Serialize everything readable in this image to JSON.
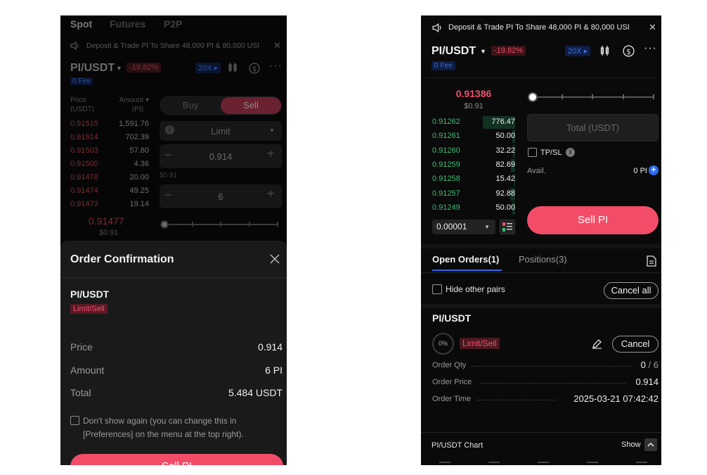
{
  "left": {
    "tabs": [
      "Spot",
      "Futures",
      "P2P"
    ],
    "announcement": "Deposit & Trade PI To Share  48,000 PI & 80,000 USI",
    "pair": "PI/USDT",
    "change": "-19.82%",
    "leverage": "20X",
    "fee_badge": "0 Fee",
    "ob_price_header": "Price",
    "ob_price_unit": "(USDT)",
    "ob_amount_header": "Amount",
    "ob_amount_unit": "(PI)",
    "asks": [
      {
        "price": "0.91515",
        "amount": "1,591.76"
      },
      {
        "price": "0.91514",
        "amount": "702.39"
      },
      {
        "price": "0.91503",
        "amount": "57.80"
      },
      {
        "price": "0.91500",
        "amount": "4.36"
      },
      {
        "price": "0.91478",
        "amount": "20.00"
      },
      {
        "price": "0.91474",
        "amount": "49.25"
      },
      {
        "price": "0.91473",
        "amount": "19.14"
      }
    ],
    "last_price": "0.91477",
    "last_usd": "$0.91",
    "buy_label": "Buy",
    "sell_label": "Sell",
    "order_type": "Limit",
    "price_value": "0.914",
    "price_hint": "$0.91",
    "amount_value": "6",
    "modal": {
      "title": "Order Confirmation",
      "pair": "PI/USDT",
      "order_tag": "Limit/Sell",
      "price_label": "Price",
      "price_value": "0.914",
      "amount_label": "Amount",
      "amount_value": "6 PI",
      "total_label": "Total",
      "total_value": "5.484 USDT",
      "dont_show_line1": "Don't show again (you can change this in",
      "dont_show_line2": "[Preferences] on the menu at the top right).",
      "sell_button": "Sell PI"
    }
  },
  "right": {
    "announcement": "Deposit & Trade PI To Share  48,000 PI & 80,000 USI",
    "pair": "PI/USDT",
    "change": "-19.82%",
    "leverage": "20X",
    "fee_badge": "0 Fee",
    "last_price": "0.91386",
    "last_usd": "$0.91",
    "bids": [
      {
        "price": "0.91262",
        "amount": "776.47"
      },
      {
        "price": "0.91261",
        "amount": "50.00"
      },
      {
        "price": "0.91260",
        "amount": "32.22"
      },
      {
        "price": "0.91259",
        "amount": "82.69"
      },
      {
        "price": "0.91258",
        "amount": "15.42"
      },
      {
        "price": "0.91257",
        "amount": "92.88"
      },
      {
        "price": "0.91249",
        "amount": "50.00"
      }
    ],
    "precision": "0.00001",
    "total_placeholder": "Total (USDT)",
    "tpsl_label": "TP/SL",
    "avail_label": "Avail.",
    "avail_value": "0 PI",
    "sell_button": "Sell PI",
    "tab_open_orders": "Open Orders(1)",
    "tab_positions": "Positions(3)",
    "hide_pairs_label": "Hide other pairs",
    "cancel_all": "Cancel all",
    "order": {
      "pair": "PI/USDT",
      "progress": "0%",
      "tag": "Limit/Sell",
      "cancel": "Cancel",
      "qty_label": "Order Qty",
      "qty_filled": "0",
      "qty_total": "/ 6",
      "price_label": "Order Price",
      "price_value": "0.914",
      "time_label": "Order Time",
      "time_value": "2025-03-21 07:42:42"
    },
    "chart_label": "PI/USDT Chart",
    "show_label": "Show"
  }
}
